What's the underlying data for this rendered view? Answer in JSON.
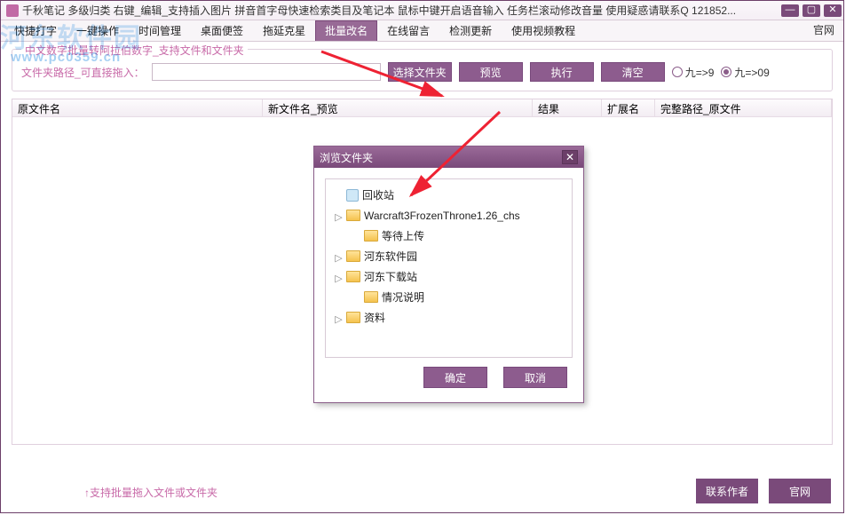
{
  "title": "千秋笔记  多级归类  右键_编辑_支持插入图片    拼音首字母快速检索类目及笔记本    鼠标中键开启语音输入    任务栏滚动修改音量  使用疑惑请联系Q  121852...",
  "official": "官网",
  "tabs": [
    "快捷打字",
    "一键操作",
    "时间管理",
    "桌面便签",
    "拖延克星",
    "批量改名",
    "在线留言",
    "检测更新",
    "使用视频教程"
  ],
  "activeTab": 5,
  "group": {
    "legend": "中文数字批量转阿拉伯数字_支持文件和文件夹",
    "pathLabel": "文件夹路径_可直接拖入：",
    "pathValue": "",
    "btnSelect": "选择文件夹",
    "btnPreview": "预览",
    "btnRun": "执行",
    "btnClear": "清空",
    "opt1": "九=>9",
    "opt2": "九=>09"
  },
  "columns": [
    "原文件名",
    "新文件名_预览",
    "结果",
    "扩展名",
    "完整路径_原文件"
  ],
  "hint": "↑支持批量拖入文件或文件夹",
  "footer": {
    "contact": "联系作者",
    "site": "官网"
  },
  "dialog": {
    "title": "浏览文件夹",
    "ok": "确定",
    "cancel": "取消",
    "tree": [
      {
        "level": 0,
        "twist": "",
        "icon": "bin",
        "label": "回收站"
      },
      {
        "level": 0,
        "twist": "▷",
        "icon": "f",
        "label": "Warcraft3FrozenThrone1.26_chs"
      },
      {
        "level": 1,
        "twist": "",
        "icon": "f",
        "label": "等待上传"
      },
      {
        "level": 0,
        "twist": "▷",
        "icon": "f",
        "label": "河东软件园"
      },
      {
        "level": 0,
        "twist": "▷",
        "icon": "f",
        "label": "河东下载站"
      },
      {
        "level": 1,
        "twist": "",
        "icon": "f",
        "label": "情况说明"
      },
      {
        "level": 0,
        "twist": "▷",
        "icon": "f",
        "label": "资料"
      }
    ]
  },
  "watermark": {
    "main": "河东软件园",
    "sub": "www.pc0359.cn"
  }
}
